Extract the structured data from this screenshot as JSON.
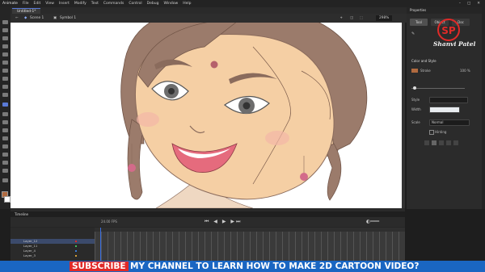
{
  "app": {
    "name": "Animate",
    "menu": [
      "File",
      "Edit",
      "View",
      "Insert",
      "Modify",
      "Text",
      "Commands",
      "Control",
      "Debug",
      "Window",
      "Help"
    ]
  },
  "document": {
    "tab": "Untitled-1*",
    "scene": "Scene 1",
    "symbol": "Symbol 1",
    "zoom": "298%"
  },
  "properties": {
    "panel_title": "Properties",
    "tabs": [
      "Tool",
      "Object",
      "Doc"
    ],
    "section": "Color and Style",
    "stroke_label": "Stroke",
    "stroke_opacity": "100 %",
    "style_label": "Style",
    "width_label": "Width",
    "scale_label": "Scale",
    "scale_value": "Normal",
    "hinting_label": "Hinting"
  },
  "timeline": {
    "title": "Timeline",
    "fps": "24.00 FPS",
    "layers": [
      "Layer_12",
      "Layer_11",
      "Layer_4",
      "Layer_3"
    ]
  },
  "logo": {
    "initials": "SP",
    "name": "Shanvi Patel"
  },
  "banner": {
    "subscribe": "SUBSCRIBE",
    "message": "MY CHANNEL TO LEARN HOW TO MAKE 2D CARTOON VIDEO?"
  },
  "colors": {
    "accent": "#1a66c2",
    "subscribe_red": "#e02a28",
    "skin": "#f5cfa4",
    "hair": "#8a6b5c",
    "bindi": "#b5616b"
  }
}
